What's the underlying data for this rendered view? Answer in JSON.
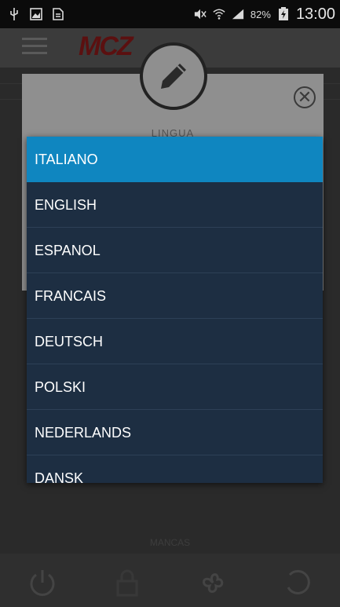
{
  "status_bar": {
    "battery": "82%",
    "time": "13:00"
  },
  "app": {
    "logo": "MCZ"
  },
  "dialog": {
    "label": "LINGUA"
  },
  "language_options": [
    {
      "label": "ITALIANO",
      "selected": true
    },
    {
      "label": "ENGLISH",
      "selected": false
    },
    {
      "label": "ESPANOL",
      "selected": false
    },
    {
      "label": "FRANCAIS",
      "selected": false
    },
    {
      "label": "DEUTSCH",
      "selected": false
    },
    {
      "label": "POLSKI",
      "selected": false
    },
    {
      "label": "NEDERLANDS",
      "selected": false
    },
    {
      "label": "DANSK",
      "selected": false
    }
  ],
  "bottom": {
    "label": "MANCAS",
    "icons": [
      "power-icon",
      "lock-icon",
      "fan-icon",
      "refresh-icon"
    ]
  },
  "colors": {
    "selected": "#0f86c0",
    "dropdown_bg": "#1d2e42"
  }
}
